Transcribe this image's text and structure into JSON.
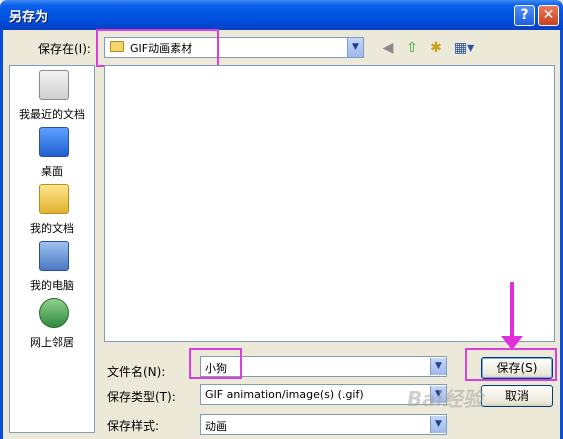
{
  "window": {
    "title": "另存为",
    "help": "?",
    "close": "✕"
  },
  "lookin": {
    "label": "保存在(I):",
    "value": "GIF动画素材"
  },
  "toolbar": {
    "back": "◀",
    "up": "⇧",
    "new_folder": "✱",
    "views": "▦▾"
  },
  "places": [
    {
      "label": "我最近的文档",
      "icon": "recent-documents-icon"
    },
    {
      "label": "桌面",
      "icon": "desktop-icon"
    },
    {
      "label": "我的文档",
      "icon": "my-documents-icon"
    },
    {
      "label": "我的电脑",
      "icon": "my-computer-icon"
    },
    {
      "label": "网上邻居",
      "icon": "network-places-icon"
    }
  ],
  "filename": {
    "label": "文件名(N):",
    "value": "小狗"
  },
  "filetype": {
    "label": "保存类型(T):",
    "value": "GIF animation/image(s) (.gif)"
  },
  "format": {
    "label": "保存样式:",
    "value": "动画"
  },
  "buttons": {
    "save": "保存(S)",
    "cancel": "取消"
  },
  "watermark": "Bai经验",
  "colors": {
    "highlight": "#d93fd9",
    "titlebar": "#0054e3"
  }
}
